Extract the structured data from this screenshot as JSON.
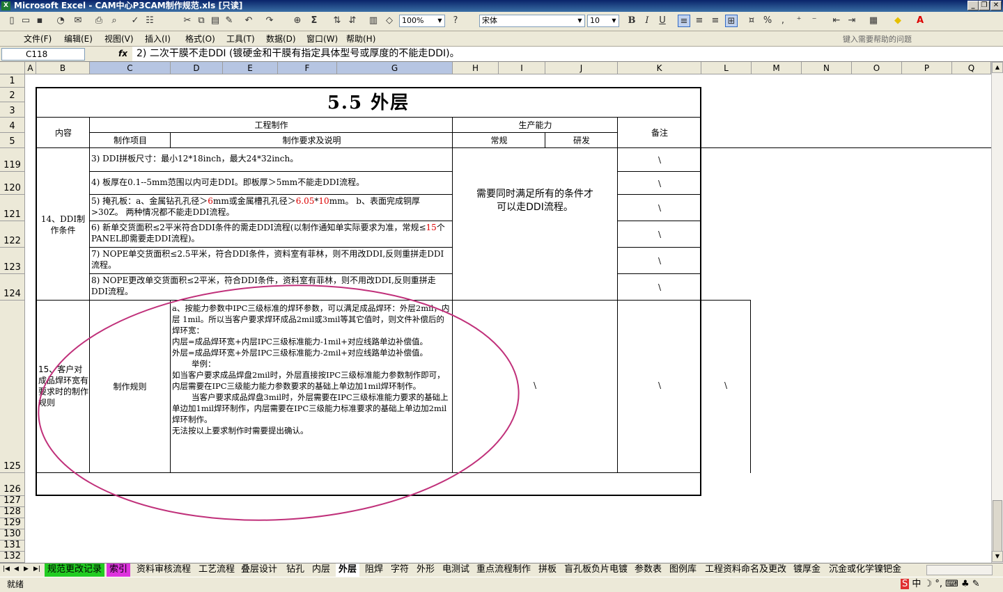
{
  "window": {
    "title": "Microsoft Excel - CAM中心P3CAM制作规范.xls [只读]",
    "app_icon": "X"
  },
  "toolbar": {
    "zoom": "100%",
    "font": "宋体",
    "size": "10",
    "sigma": "Σ"
  },
  "menu": [
    "文件(F)",
    "编辑(E)",
    "视图(V)",
    "插入(I)",
    "格式(O)",
    "工具(T)",
    "数据(D)",
    "窗口(W)",
    "帮助(H)"
  ],
  "help_placeholder": "键入需要帮助的问题",
  "formula": {
    "cell": "C118",
    "fx": "fx",
    "content": "2) 二次干膜不走DDI (镀硬金和干膜有指定具体型号或厚度的不能走DDI)。"
  },
  "columns": [
    "A",
    "B",
    "C",
    "D",
    "E",
    "F",
    "G",
    "H",
    "I",
    "J",
    "K",
    "L",
    "M",
    "N",
    "O",
    "P",
    "Q"
  ],
  "rows": [
    "1",
    "2",
    "3",
    "4",
    "5",
    "119",
    "120",
    "121",
    "122",
    "123",
    "124",
    "125",
    "126",
    "127",
    "128",
    "129",
    "130",
    "131",
    "132"
  ],
  "sheet": {
    "title": "5.5 外层",
    "hdr_content": "内容",
    "hdr_eng": "工程制作",
    "hdr_prod": "生产能力",
    "hdr_note": "备注",
    "hdr_item": "制作项目",
    "hdr_req": "制作要求及说明",
    "hdr_normal": "常规",
    "hdr_rd": "研发",
    "ddi_label": "14、DDI制作条件",
    "ddi_rows": [
      "3) DDI拼板尺寸：最小12*18inch，最大24*32inch。",
      "4) 板厚在0.1--5mm范围以内可走DDI。即板厚＞5mm不能走DDI流程。",
      "5) 掩孔板：a、金属钻孔孔径＞6mm或金属槽孔孔径＞6.05*10mm。 b、表面完成铜厚>30Z。 两种情况都不能走DDI流程。",
      "6) 新单交货面积≤2平米符合DDI条件的需走DDI流程(以制作通知单实际要求为准，常规≤15个PANEL即需要走DDI流程)。",
      "7) NOPE单交货面积≤2.5平米，符合DDI条件，资料室有菲林，则不用改DDI,反则重拼走DDI流程。",
      "8) NOPE更改单交货面积≤2平米，符合DDI条件，资料室有菲林，则不用改DDI,反则重拼走DDI流程。"
    ],
    "ddi_row5_parts": {
      "a": "5) 掩孔板：a、金属钻孔孔径＞",
      "r1": "6",
      "b": "mm或金属槽孔孔径＞",
      "r2": "6.05",
      "c": "*",
      "r3": "10",
      "d": "mm。 b、表面完成铜厚>30Z。 两种情况都不能走DDI流程。"
    },
    "ddi_row6_parts": {
      "a": "6) 新单交货面积≤2平米符合DDI条件的需走DDI流程(以制作通知单实际要求为准，常规≤",
      "r": "15",
      "b": "个PANEL即需要走DDI流程)。"
    },
    "ddi_capability": "需要同时满足所有的条件才可以走DDI流程。",
    "ddi_note": "\\",
    "ring_label": "15、客户对成品焊环宽有要求时的制作规则",
    "ring_item": "制作规则",
    "ring_text": [
      "a、按能力参数中IPC三级标准的焊环参数，可以满足成品焊环：外层2mil，内层 1mil。所以当客户要求焊环成品2mil或3mil等其它值时，则文件补偿后的焊环宽：",
      "内层=成品焊环宽+内层IPC三级标准能力-1mil+对应线路单边补偿值。",
      "外层=成品焊环宽+外层IPC三级标准能力-2mil+对应线路单边补偿值。",
      "举例：",
      "如当客户要求成品焊盘2mil时，外层直接按IPC三级标准能力参数制作即可，内层需要在IPC三级能力能力参数要求的基础上单边加1mil焊环制作。",
      "当客户要求成品焊盘3mil时，外层需要在IPC三级标准能力要求的基础上单边加1mil焊环制作，内层需要在IPC三级能力标准要求的基础上单边加2mil焊环制作。",
      "无法按以上要求制作时需要提出确认。"
    ],
    "ring_cap": "\\",
    "ring_note": "\\",
    "ring_extra": "\\"
  },
  "tabs": [
    "规范更改记录",
    "索引",
    "资料审核流程",
    "工艺流程",
    "叠层设计",
    "钻孔",
    "内层",
    "外层",
    "阻焊",
    "字符",
    "外形",
    "电测试",
    "重点流程制作",
    "拼板",
    "盲孔板负片电镀",
    "参数表",
    "图例库",
    "工程资料命名及更改",
    "镀厚金",
    "沉金或化学镍钯金"
  ],
  "status": "就绪",
  "ime": "中"
}
